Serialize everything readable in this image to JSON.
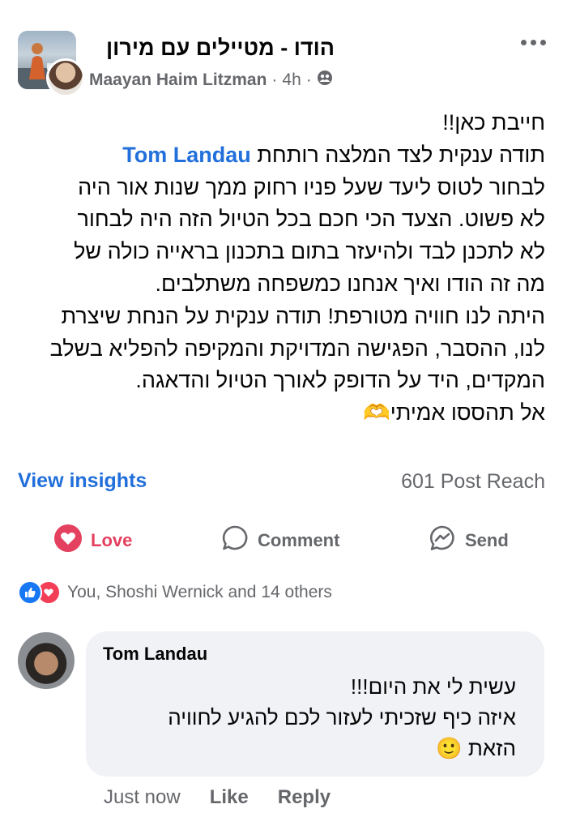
{
  "post": {
    "group_name": "הודו - מטיילים עם מירון",
    "author": "Maayan Haim Litzman",
    "time": "4h",
    "separator": "·",
    "body_lines": [
      "חייבת כאן!!",
      "תודה ענקית לצד המלצה רותחת",
      "לבחור לטוס ליעד שעל פניו רחוק ממך שנות אור היה",
      "לא פשוט. הצעד הכי חכם בכל הטיול הזה היה לבחור",
      "לא לתכנן לבד ולהיעזר בתום בתכנון בראייה כולה של",
      "מה זה הודו ואיך אנחנו כמשפחה משתלבים.",
      "היתה לנו חוויה מטורפת! תודה ענקית על הנחת שיצרת",
      "לנו, ההסבר, הפגישה המדויקת והמקיפה להפליא בשלב",
      "המקדים, היד על הדופק לאורך הטיול והדאגה.",
      "אל תהססו אמיתי"
    ],
    "mention": "Tom Landau",
    "emoji_heart_hands": "🫶"
  },
  "insights": {
    "view_label": "View insights",
    "reach": "601 Post Reach"
  },
  "actions": {
    "love": "Love",
    "comment": "Comment",
    "send": "Send"
  },
  "reactions": {
    "text": "You, Shoshi Wernick and 14 others",
    "icons": [
      "like-icon",
      "love-icon"
    ]
  },
  "comment": {
    "author": "Tom Landau",
    "lines": [
      "עשית לי את היום!!!",
      "איזה כיף שזכיתי לעזור לכם להגיע לחוויה",
      "הזאת"
    ],
    "emoji": "🙂",
    "time": "Just now",
    "like": "Like",
    "reply": "Reply"
  },
  "colors": {
    "accent": "#216fdb",
    "love": "#e4405f",
    "muted": "#65676b",
    "bubble": "#f0f2f5"
  }
}
